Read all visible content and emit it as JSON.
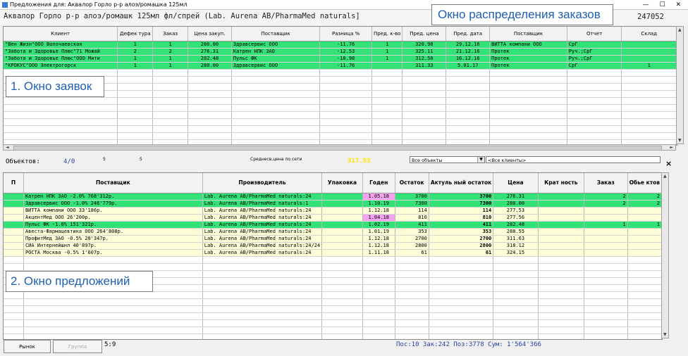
{
  "window": {
    "title": "Предложения для: Аквалор Горло р-р алоэ/ромашка 125мл",
    "controls": "— ☐ ✕"
  },
  "header": {
    "product": "Аквалор Горло р-р алоэ/ромашк 125мл фл/спрей (Lab. Aurena AB/PharmaMed naturals]",
    "code": "247052"
  },
  "annotations": {
    "distribution": "Окно распределения заказов",
    "requests": "1. Окно заявок",
    "offers": "2. Окно предложений"
  },
  "requests": {
    "columns": [
      "Клиент",
      "Дефек тура",
      "Заказ",
      "Цена закуп.",
      "Поставщик",
      "Разница %",
      "Пред. к-во",
      "Пред. цена",
      "Пред. дата",
      "Поставщик",
      "Отчет",
      "Склад"
    ],
    "rows": [
      [
        "\"Вен Жизн\"ООО Волочаевская",
        "1",
        "1",
        "280.00",
        "Здравсервис ООО",
        "-11.76",
        "1",
        "320.98",
        "29.12.16",
        "ВИТТА компани ООО",
        "СрГ",
        ""
      ],
      [
        "\"Забота и Здоровье Плюс\"71 Можай",
        "2",
        "2",
        "276.31",
        "Катрен НПК ЗАО",
        "-12.53",
        "1",
        "325.11",
        "21.12.16",
        "Протек",
        "Руч.;СрГ",
        ""
      ],
      [
        "\"Забота и Здоровье Плюс\"ООО Мити",
        "1",
        "1",
        "282.48",
        "Пульс ФК",
        "-10.98",
        "1",
        "312.50",
        "16.12.16",
        "Протек",
        "Руч.;СрГ",
        ""
      ],
      [
        "\"КРОКУС\"ООО Электрогорск",
        "1",
        "1",
        "280.00",
        "Здравсервис ООО",
        "-11.76",
        "",
        "311.33",
        "5.01.17",
        "Протек",
        "СрГ",
        "1"
      ]
    ]
  },
  "summary": {
    "label": "Объектов:",
    "count": "4/0",
    "n1": "5",
    "n2": "5",
    "avg_label": "Среднесв.цена по сети",
    "avg_value": "317.93",
    "filter_objects": "Все объекты",
    "filter_clients": "<Все клиенты>",
    "close": "×"
  },
  "offers": {
    "columns": [
      "П",
      "Поставщик",
      "Производитель",
      "Упаковка",
      "Годен",
      "Остаток",
      "Актуль ный остаток",
      "Цена",
      "Крат ность",
      "Заказ",
      "Обье ктов"
    ],
    "rows": [
      {
        "supplier": "Катрен НПК ЗАО      -2.0%     768'312р.",
        "maker": "Lab. Aurena AB/PharmaMed naturals:24",
        "pack": "",
        "exp": "1.05.18",
        "stock": "3700",
        "actual": "3700",
        "price": "276.31",
        "mult": "",
        "order": "2",
        "objs": "2",
        "color": "green",
        "pink": true
      },
      {
        "supplier": "Здравсервис ООО     -1.0%     246'779р.",
        "maker": "Lab. Aurena AB/PharmaMed naturals:1",
        "pack": "",
        "exp": "1.10.19",
        "stock": "7300",
        "actual": "7300",
        "price": "280.00",
        "mult": "",
        "order": "2",
        "objs": "2",
        "color": "green",
        "pink": false
      },
      {
        "supplier": "ВИТТА компани ООО             33'186р.",
        "maker": "Lab. Aurena AB/PharmaMed naturals:24",
        "pack": "",
        "exp": "1.12.18",
        "stock": "114",
        "actual": "114",
        "price": "277.53",
        "mult": "",
        "order": "",
        "objs": "",
        "color": "yellow",
        "pink": false
      },
      {
        "supplier": "АкцентМед ООО                 26'200р.",
        "maker": "Lab. Aurena AB/PharmaMed naturals:24",
        "pack": "",
        "exp": "1.04.18",
        "stock": "810",
        "actual": "810",
        "price": "277.56",
        "mult": "",
        "order": "",
        "objs": "",
        "color": "yellow",
        "pink": true
      },
      {
        "supplier": "Пульс ФК            -1.0%     151'321р.",
        "maker": "Lab. Aurena AB/PharmaMed naturals:24",
        "pack": "",
        "exp": "1.02.19",
        "stock": "411",
        "actual": "411",
        "price": "282.48",
        "mult": "",
        "order": "1",
        "objs": "1",
        "color": "green",
        "pink": false
      },
      {
        "supplier": "Авеста-Фармацевтика ООО      264'808р.",
        "maker": "Lab. Aurena AB/PharmaMed naturals:24",
        "pack": "",
        "exp": "1.01.19",
        "stock": "353",
        "actual": "353",
        "price": "288.55",
        "mult": "",
        "order": "",
        "objs": "",
        "color": "yellow",
        "pink": false
      },
      {
        "supplier": "ПрофитМед ЗАО       -0.5%      28'347р.",
        "maker": "Lab. Aurena AB/PharmaMed naturals:24",
        "pack": "",
        "exp": "1.12.18",
        "stock": "2700",
        "actual": "2700",
        "price": "311.63",
        "mult": "",
        "order": "",
        "objs": "",
        "color": "yellow",
        "pink": false
      },
      {
        "supplier": "СИА Интернейшнл               40'897р.",
        "maker": "Lab. Aurena AB/PharmaMed naturals:24/24",
        "pack": "",
        "exp": "1.12.18",
        "stock": "2800",
        "actual": "2800",
        "price": "318.12",
        "mult": "",
        "order": "",
        "objs": "",
        "color": "yellow",
        "pink": false
      },
      {
        "supplier": "РОСТА Москва        -0.5%      1'607р.",
        "maker": "Lab. Aurena AB/PharmaMed naturals:24",
        "pack": "",
        "exp": "1.11.18",
        "stock": "61",
        "actual": "61",
        "price": "324.15",
        "mult": "",
        "order": "",
        "objs": "",
        "color": "yellow",
        "pink": false
      }
    ]
  },
  "footer": {
    "market_btn": "Рынок",
    "group_btn": "Группа",
    "ratio": "5:9",
    "status": "Пос:10 Зак:242 Поз:3778 Сум: 1'564'366"
  }
}
